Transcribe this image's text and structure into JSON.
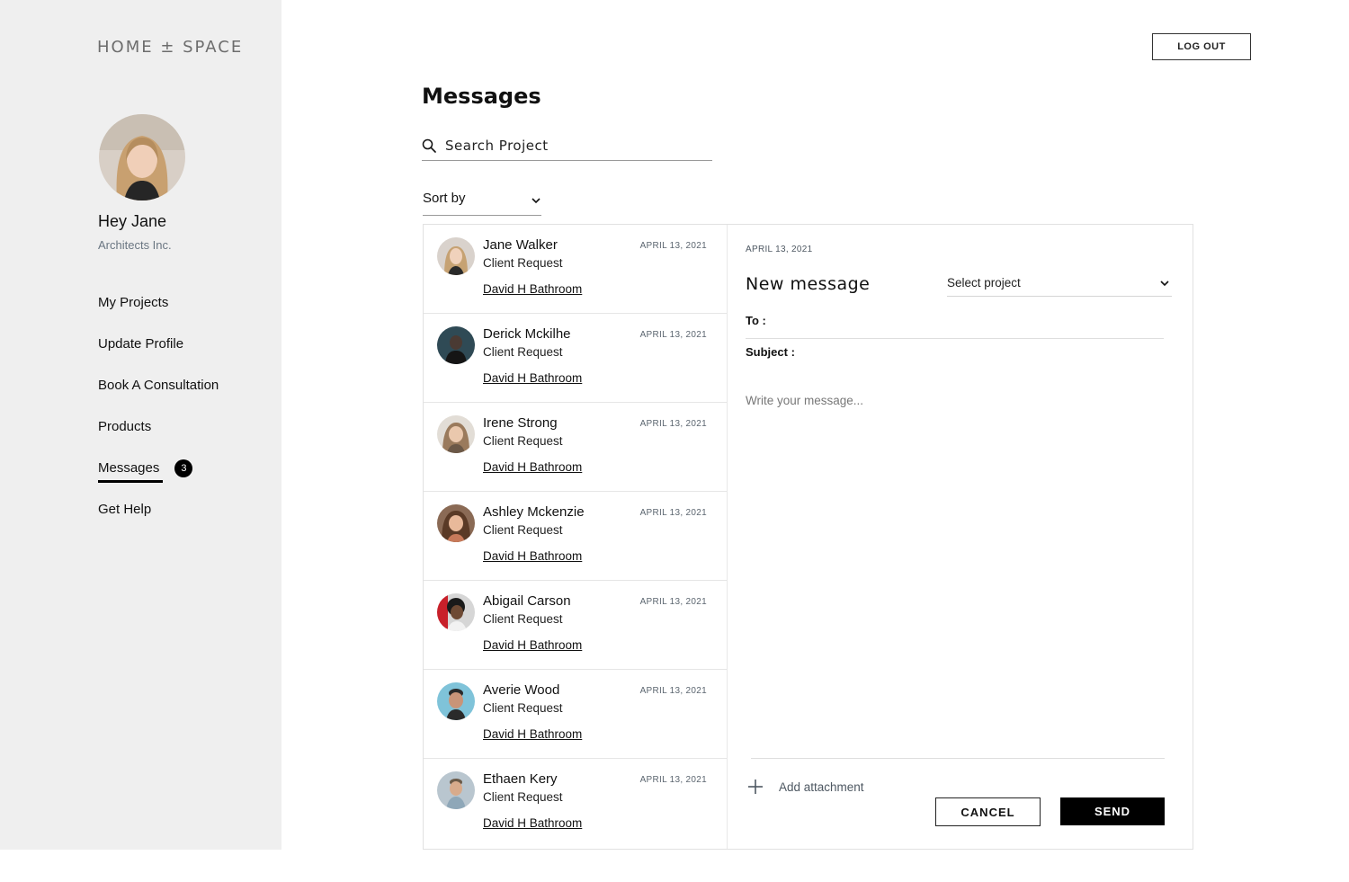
{
  "brand": {
    "logo_text": "HOME ± SPACE"
  },
  "user": {
    "greeting": "Hey Jane",
    "company": "Architects Inc."
  },
  "nav": {
    "items": [
      {
        "label": "My Projects"
      },
      {
        "label": "Update Profile"
      },
      {
        "label": "Book A Consultation"
      },
      {
        "label": "Products"
      },
      {
        "label": "Messages",
        "active": true,
        "badge": "3"
      },
      {
        "label": "Get Help"
      }
    ]
  },
  "header": {
    "logout_label": "LOG OUT"
  },
  "main": {
    "title": "Messages",
    "search_placeholder": "Search Project",
    "sort_label": "Sort by"
  },
  "messages": [
    {
      "name": "Jane Walker",
      "type": "Client Request",
      "date": "APRIL 13, 2021",
      "project": "David H Bathroom"
    },
    {
      "name": "Derick Mckilhe",
      "type": "Client Request",
      "date": "APRIL 13, 2021",
      "project": "David H Bathroom"
    },
    {
      "name": "Irene Strong",
      "type": "Client Request",
      "date": "APRIL 13, 2021",
      "project": "David H Bathroom"
    },
    {
      "name": "Ashley Mckenzie",
      "type": "Client Request",
      "date": "APRIL 13, 2021",
      "project": "David H Bathroom"
    },
    {
      "name": "Abigail Carson",
      "type": "Client Request",
      "date": "APRIL 13, 2021",
      "project": "David H Bathroom"
    },
    {
      "name": "Averie Wood",
      "type": "Client Request",
      "date": "APRIL 13, 2021",
      "project": "David H Bathroom"
    },
    {
      "name": "Ethaen Kery",
      "type": "Client Request",
      "date": "APRIL 13, 2021",
      "project": "David H Bathroom"
    }
  ],
  "compose": {
    "date": "APRIL 13, 2021",
    "title": "New message",
    "select_project": "Select project",
    "to_label": "To :",
    "subject_label": "Subject :",
    "body_placeholder": "Write your message...",
    "attach_label": "Add attachment",
    "cancel_label": "CANCEL",
    "send_label": "SEND"
  },
  "colors": {
    "sidebar_bg": "#efefef",
    "accent": "#000000",
    "muted": "#5c6670"
  }
}
